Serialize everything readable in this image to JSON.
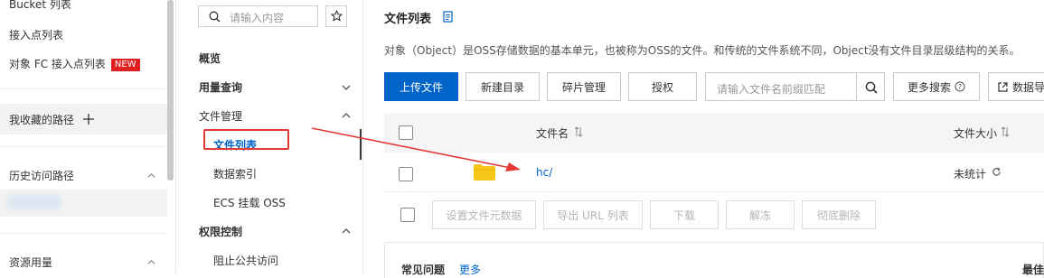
{
  "left_sidebar": {
    "items": [
      {
        "label": "Bucket 列表"
      },
      {
        "label": "接入点列表"
      },
      {
        "label": "对象 FC 接入点列表",
        "badge": "NEW"
      }
    ],
    "favorites_label": "我收藏的路径",
    "history_label": "历史访问路径",
    "resources_label": "资源用量"
  },
  "nav": {
    "search_placeholder": "请输入内容",
    "items": [
      {
        "label": "概览"
      },
      {
        "label": "用量查询"
      },
      {
        "label": "文件管理"
      },
      {
        "label": "文件列表"
      },
      {
        "label": "数据索引"
      },
      {
        "label": "ECS 挂载 OSS"
      },
      {
        "label": "权限控制"
      },
      {
        "label": "阻止公共访问"
      }
    ]
  },
  "main": {
    "title": "文件列表",
    "description": "对象（Object）是OSS存储数据的基本单元，也被称为OSS的文件。和传统的文件系统不同，Object没有文件目录层级结构的关系。",
    "toolbar": {
      "upload": "上传文件",
      "new_dir": "新建目录",
      "fragments": "碎片管理",
      "authorize": "授权",
      "search_placeholder": "请输入文件名前缀匹配",
      "more_search": "更多搜索",
      "export": "数据导"
    },
    "table": {
      "col_name": "文件名",
      "col_size": "文件大小",
      "rows": [
        {
          "name": "hc/",
          "size": "未统计"
        }
      ]
    },
    "batch_actions": {
      "set_meta": "设置文件元数据",
      "export_url": "导出 URL 列表",
      "download": "下载",
      "unfreeze": "解冻",
      "delete": "彻底删除"
    },
    "faq": {
      "title": "常见问题",
      "more": "更多",
      "right": "最佳"
    }
  },
  "colors": {
    "primary": "#0064c8",
    "badge": "#e02020",
    "annotation": "#e53935",
    "folder": "#f5c518"
  }
}
